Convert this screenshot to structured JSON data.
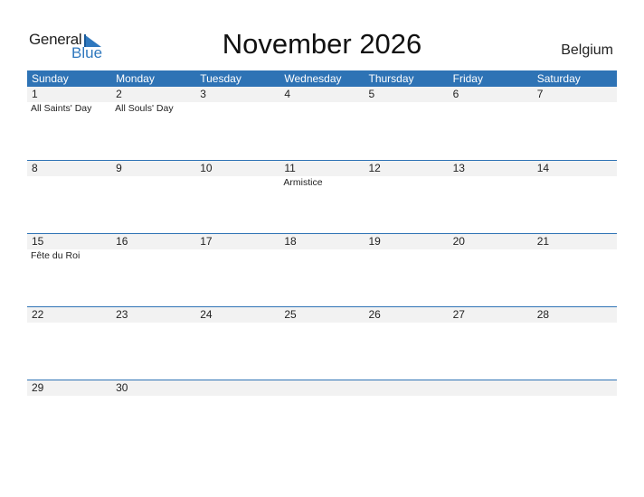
{
  "brand": {
    "line1": "General",
    "line2": "Blue",
    "icon": "triangle-flag-icon",
    "accent": "#2f78be"
  },
  "title": "November 2026",
  "country": "Belgium",
  "colors": {
    "header_bg": "#2e73b5",
    "strip_bg": "#f2f2f2"
  },
  "weekdays": [
    "Sunday",
    "Monday",
    "Tuesday",
    "Wednesday",
    "Thursday",
    "Friday",
    "Saturday"
  ],
  "weeks": [
    {
      "days": [
        "1",
        "2",
        "3",
        "4",
        "5",
        "6",
        "7"
      ],
      "events": [
        "All Saints' Day",
        "All Souls' Day",
        "",
        "",
        "",
        "",
        ""
      ]
    },
    {
      "days": [
        "8",
        "9",
        "10",
        "11",
        "12",
        "13",
        "14"
      ],
      "events": [
        "",
        "",
        "",
        "Armistice",
        "",
        "",
        ""
      ]
    },
    {
      "days": [
        "15",
        "16",
        "17",
        "18",
        "19",
        "20",
        "21"
      ],
      "events": [
        "Fête du Roi",
        "",
        "",
        "",
        "",
        "",
        ""
      ]
    },
    {
      "days": [
        "22",
        "23",
        "24",
        "25",
        "26",
        "27",
        "28"
      ],
      "events": [
        "",
        "",
        "",
        "",
        "",
        "",
        ""
      ]
    },
    {
      "days": [
        "29",
        "30",
        "",
        "",
        "",
        "",
        ""
      ],
      "events": [
        "",
        "",
        "",
        "",
        "",
        "",
        ""
      ]
    }
  ]
}
